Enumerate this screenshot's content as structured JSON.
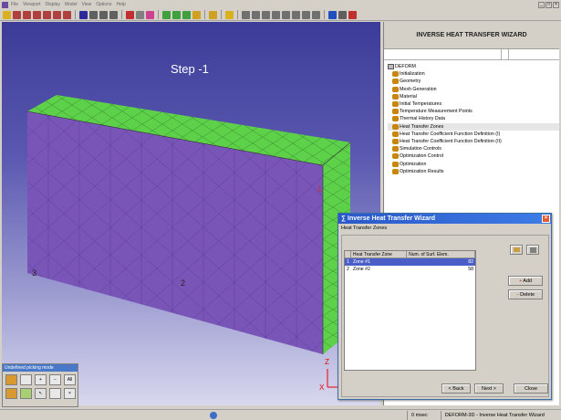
{
  "menubar": {
    "items": [
      "File",
      "Viewport",
      "Display",
      "Model",
      "View",
      "Options",
      "Help"
    ]
  },
  "viewport": {
    "step_label": "Step -1",
    "labels": {
      "p1": "1",
      "p2": "2",
      "p3": "3"
    },
    "axis": {
      "z": "Z",
      "x": "X"
    }
  },
  "wizard": {
    "title": "INVERSE HEAT TRANSFER WIZARD",
    "tree": {
      "root": "DEFORM",
      "items": [
        "Initialization",
        "Geometry",
        "Mesh Generation",
        "Material",
        "Initial Temperatures",
        "Temperature Measurement Points",
        "Thermal History Data",
        "Heat Transfer Zones",
        "Heat Transfer Coefficient Function Definition (I)",
        "Heat Transfer Coefficient Function Definition (II)",
        "Simulation Controls",
        "Optimization Control",
        "Optimization",
        "Optimization Results"
      ],
      "selected": "Heat Transfer Zones"
    }
  },
  "dialog": {
    "title": "Inverse Heat Transfer Wizard",
    "section": "Heat Transfer Zones",
    "columns": [
      "Heat Transfer Zone",
      "Num. of Surf. Elem."
    ],
    "rows": [
      {
        "idx": "1",
        "zone": "Zone #1",
        "elems": "82"
      },
      {
        "idx": "2",
        "zone": "Zone #2",
        "elems": "58"
      }
    ],
    "buttons": {
      "add": "Add",
      "delete": "Delete",
      "back": "< Back",
      "next": "Next >",
      "close": "Close"
    }
  },
  "taskpanel": {
    "title": "Undefined picking mode",
    "all_label": "All"
  },
  "statusbar": {
    "time": "0 msec",
    "app": "DEFORM-3D - Inverse Heat Transfer Wizard"
  },
  "colors": {
    "top_face": "#5ed14a",
    "front_face": "#7a55b8",
    "accent": "#3b5cc8"
  }
}
